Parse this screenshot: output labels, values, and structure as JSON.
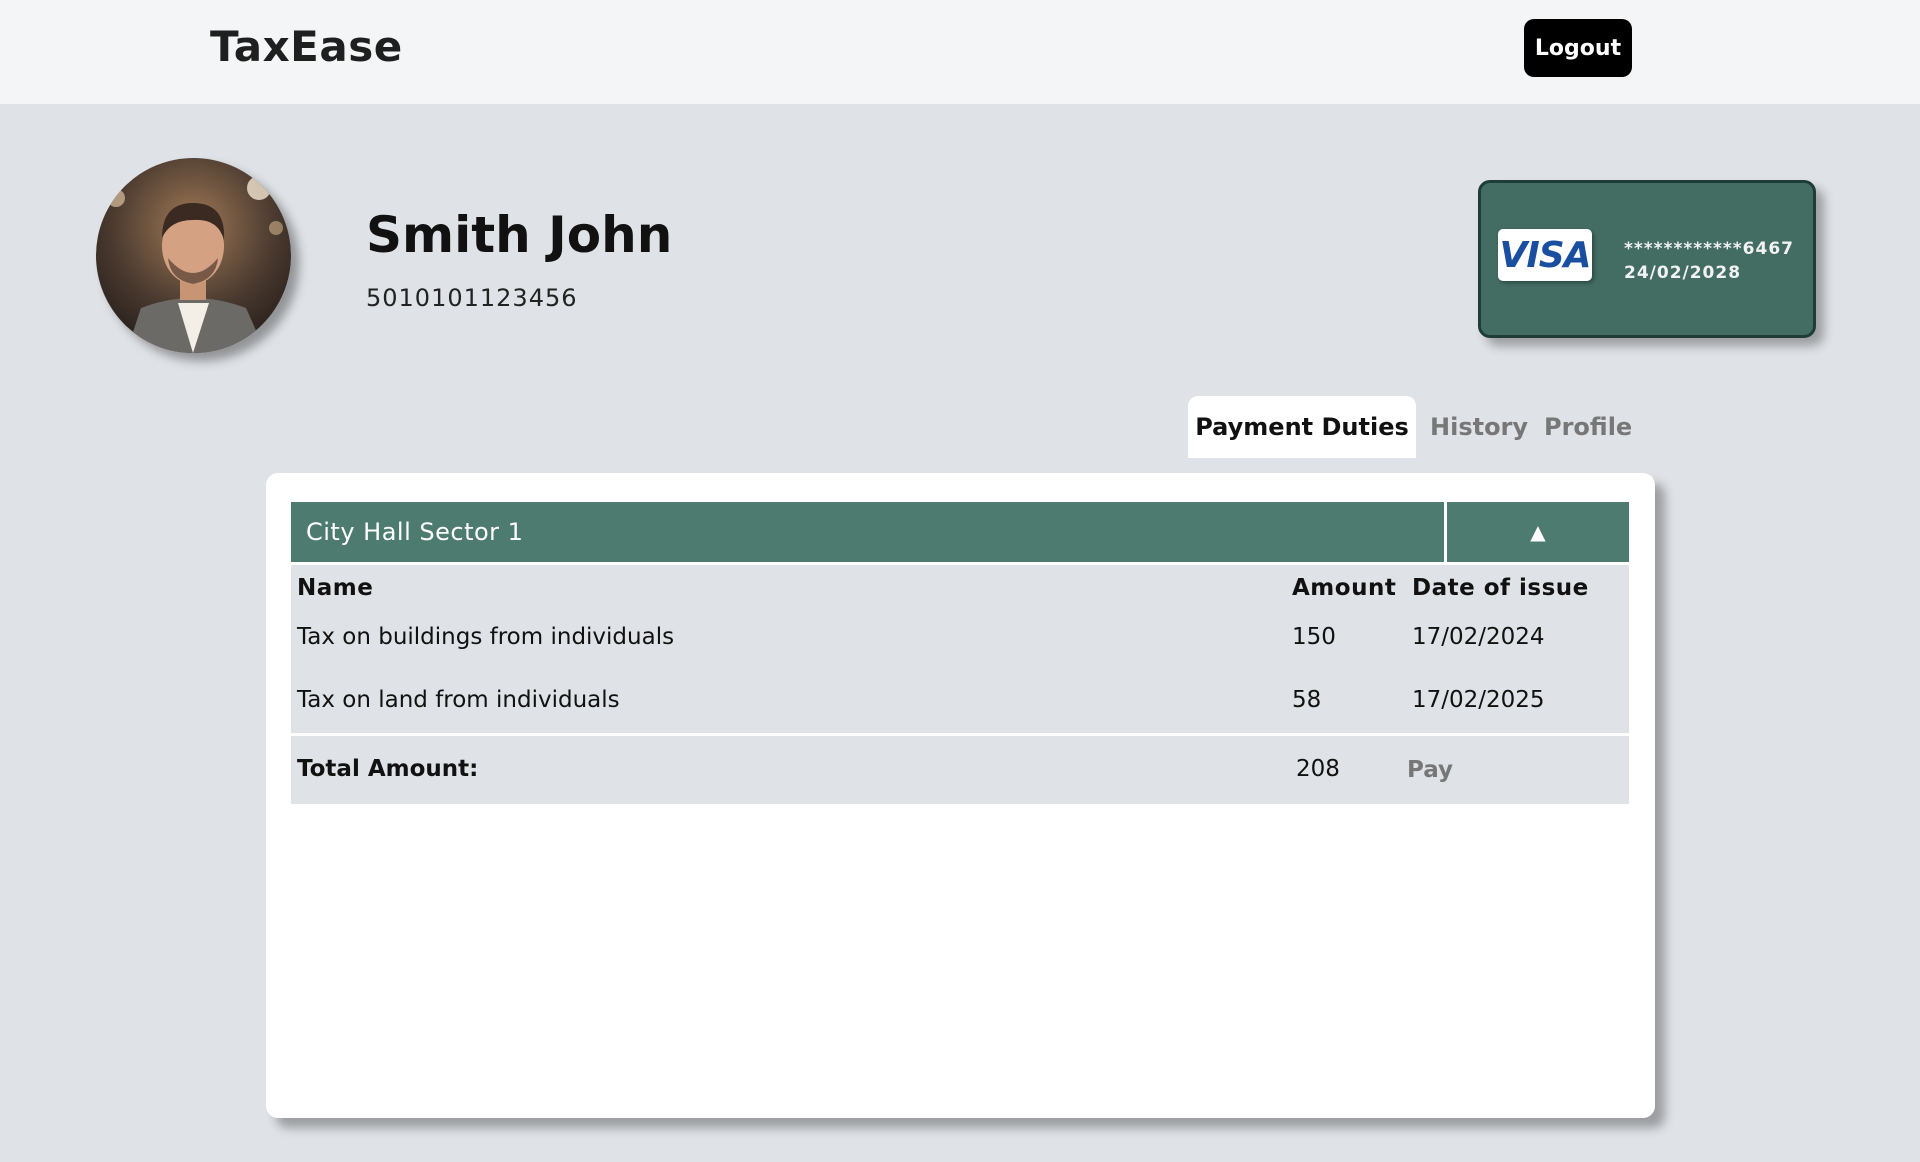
{
  "header": {
    "brand": "TaxEase",
    "logout_label": "Logout"
  },
  "user": {
    "name": "Smith John",
    "id_number": "5010101123456"
  },
  "card": {
    "brand": "VISA",
    "masked_number": "************6467",
    "expiry": "24/02/2028"
  },
  "tabs": [
    {
      "label": "Payment Duties",
      "active": true
    },
    {
      "label": "History",
      "active": false
    },
    {
      "label": "Profile",
      "active": false
    }
  ],
  "sector": {
    "title": "City Hall Sector 1",
    "toggle_icon": "▲",
    "columns": [
      "Name",
      "Amount",
      "Date of issue"
    ],
    "rows": [
      {
        "name": "Tax on buildings from individuals",
        "amount": "150",
        "date": "17/02/2024"
      },
      {
        "name": "Tax on land from individuals",
        "amount": "58",
        "date": "17/02/2025"
      }
    ],
    "total_label": "Total Amount:",
    "total_value": "208",
    "pay_label": "Pay"
  },
  "colors": {
    "accent_green": "#4e7b6f",
    "card_green": "#436d63",
    "background": "#dfe2e6"
  }
}
